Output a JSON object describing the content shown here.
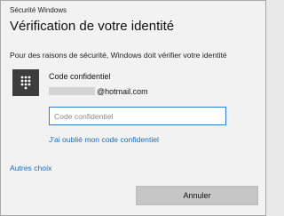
{
  "window": {
    "title": "Sécurité Windows"
  },
  "dialog": {
    "heading": "Vérification de votre identité",
    "description": "Pour des raisons de sécurité, Windows doit vérifier votre identité"
  },
  "credential": {
    "icon": "pin-keypad-icon",
    "label": "Code confidentiel",
    "account_suffix": "@hotmail.com"
  },
  "pin_input": {
    "placeholder": "Code confidentiel",
    "value": ""
  },
  "links": {
    "forgot_pin": "J'ai oublié mon code confidentiel",
    "more_choices": "Autres choix"
  },
  "buttons": {
    "cancel": "Annuler"
  },
  "colors": {
    "accent": "#1a6fc4",
    "input_border": "#2f7fd1",
    "tile": "#3d3d3d",
    "button": "#c6c6c6"
  }
}
